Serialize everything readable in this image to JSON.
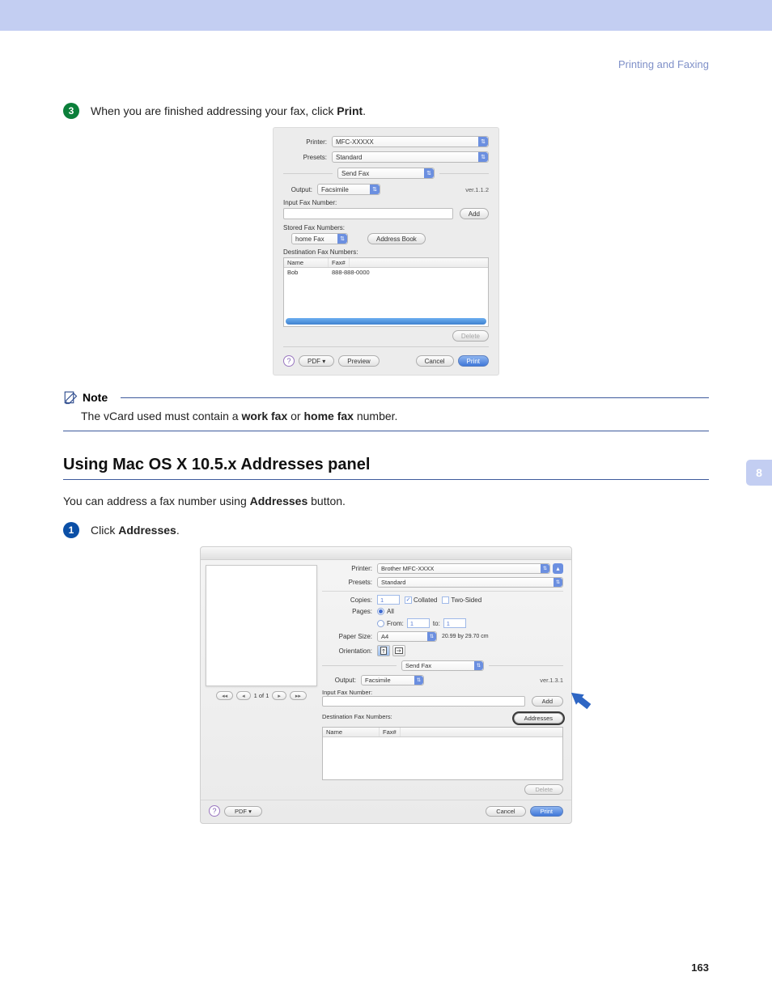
{
  "header": {
    "breadcrumb": "Printing and Faxing"
  },
  "step3": {
    "num": "3",
    "text_a": "When you are finished addressing your fax, click ",
    "text_b": "Print",
    "text_c": "."
  },
  "dialog1": {
    "printer_label": "Printer:",
    "printer_value": "MFC-XXXXX",
    "presets_label": "Presets:",
    "presets_value": "Standard",
    "panel_value": "Send Fax",
    "output_label": "Output:",
    "output_value": "Facsimile",
    "version": "ver.1.1.2",
    "input_fax_label": "Input Fax Number:",
    "add_btn": "Add",
    "stored_label": "Stored Fax Numbers:",
    "stored_value": "home Fax",
    "addrbook_btn": "Address Book",
    "dest_label": "Destination Fax Numbers:",
    "col_name": "Name",
    "col_fax": "Fax#",
    "row_name": "Bob",
    "row_fax": "888-888-0000",
    "delete_btn": "Delete",
    "help": "?",
    "pdf_btn": "PDF ▾",
    "preview_btn": "Preview",
    "cancel_btn": "Cancel",
    "print_btn": "Print"
  },
  "note": {
    "title": "Note",
    "body_a": "The vCard used must contain a ",
    "body_b": "work fax",
    "body_c": " or ",
    "body_d": "home fax",
    "body_e": " number."
  },
  "section": {
    "heading": "Using Mac OS X 10.5.x Addresses panel",
    "para_a": "You can address a fax number using ",
    "para_b": "Addresses",
    "para_c": " button."
  },
  "step1": {
    "num": "1",
    "text_a": "Click ",
    "text_b": "Addresses",
    "text_c": "."
  },
  "thumb": "8",
  "dialog2": {
    "pager_text": "1 of 1",
    "printer_label": "Printer:",
    "printer_value": "Brother MFC-XXXX",
    "presets_label": "Presets:",
    "presets_value": "Standard",
    "copies_label": "Copies:",
    "copies_value": "1",
    "collated_label": "Collated",
    "twosided_label": "Two-Sided",
    "pages_label": "Pages:",
    "pages_all": "All",
    "pages_from": "From:",
    "pages_from_val": "1",
    "pages_to": "to:",
    "pages_to_val": "1",
    "papersize_label": "Paper Size:",
    "papersize_value": "A4",
    "papersize_dim": "20.99 by 29.70 cm",
    "orientation_label": "Orientation:",
    "panel_value": "Send Fax",
    "output_label": "Output:",
    "output_value": "Facsimile",
    "version": "ver.1.3.1",
    "input_fax_label": "Input Fax Number:",
    "add_btn": "Add",
    "dest_label": "Destination Fax Numbers:",
    "addresses_btn": "Addresses",
    "col_name": "Name",
    "col_fax": "Fax#",
    "delete_btn": "Delete",
    "help": "?",
    "pdf_btn": "PDF ▾",
    "cancel_btn": "Cancel",
    "print_btn": "Print"
  },
  "page_number": "163"
}
